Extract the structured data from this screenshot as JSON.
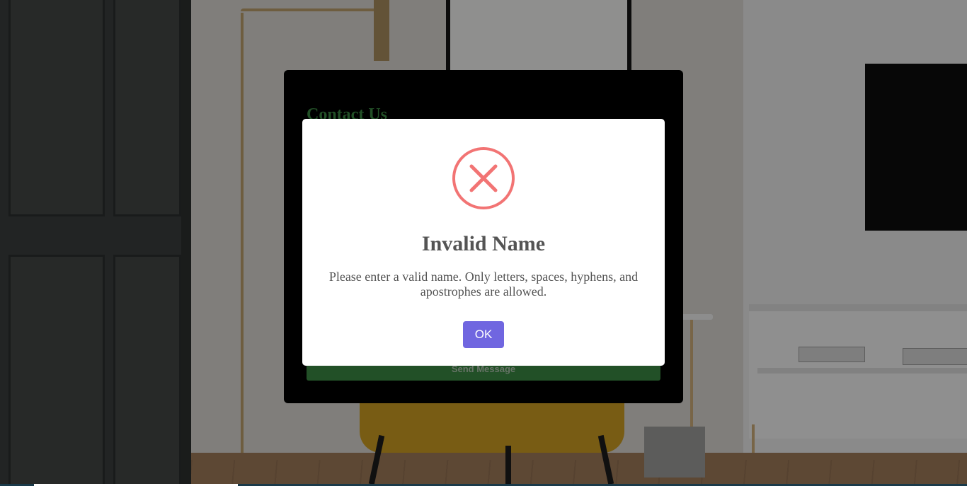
{
  "contact_card": {
    "title": "Contact Us",
    "send_button_label": "Send Message"
  },
  "modal": {
    "icon": "error-x-circle-icon",
    "title": "Invalid Name",
    "message": "Please enter a valid name. Only letters, spaces, hyphens, and apostrophes are allowed.",
    "ok_label": "OK"
  },
  "colors": {
    "ok_button": "#7066e0",
    "error_icon": "#f27474",
    "title_green": "#2e6b34",
    "modal_text": "#545454"
  }
}
